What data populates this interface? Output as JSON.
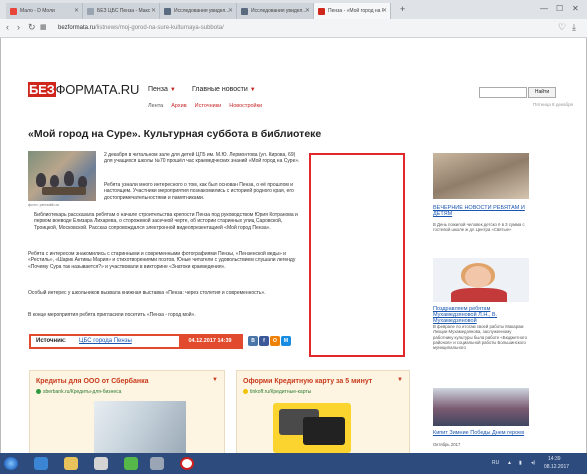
{
  "browser": {
    "tabs": [
      {
        "title": "Мало - D Моли",
        "icon_color": "#e8443a"
      },
      {
        "title": "БЕЗ ЦБС Пенза - Макс",
        "icon_color": "#9aa4b0"
      },
      {
        "title": "Исследования увидел...",
        "icon_color": "#5a6b80"
      },
      {
        "title": "Исследования увидел...",
        "icon_color": "#5a6b80"
      },
      {
        "title": "Пенза - «Мой город на С",
        "icon_color": "#d0271d"
      }
    ],
    "active_tab": 4,
    "url_host": "bezformata.ru",
    "url_path": "/listnews/moj-gorod-na-sure-kulturnaya-subbota/"
  },
  "site": {
    "logo_bez": "БЕЗ",
    "logo_rest": "ФОРМАТА.RU",
    "city": "Пенза",
    "main_news": "Главные новости",
    "subnav": [
      "Лента",
      "Архив",
      "Источники",
      "Новостройки"
    ],
    "search_button": "Найти",
    "date_line": "Пятница 8 декабря"
  },
  "article": {
    "title": "«Мой город на Суре». Культурная суббота в библиотеке",
    "image_caption": "фото: penzalib.ru",
    "p1": "2 декабря в читальном зале для детей ЦГБ им. М.Ю. Лермонтова (ул. Кирова, 69) для учащихся школы №70 прошёл час краеведческих знаний «Мой город на Суре».",
    "p2": "Ребята узнали много интересного о том, как был основан Пенза, о её прошлом и настоящем. Участники мероприятия познакомились с историей родного края, его достопримечательностями и памятниками.",
    "p3": "Библиотекарь рассказала ребятам о начале строительства крепости Пенза под руководством Юрия Котранова и первом воеводе Елизара Лихарева, о сторожевой засечной черте, об истории старинных улиц Саровской, Троицкой, Московской. Рассказ сопровождался электронной видеопрезентацией «Мой город Пенза».",
    "p4": "Ребята с интересом знакомились с старинными и современными фотографиями Пензы, «Пензенской веды» и «Рестиль», «Шарик Активы Мария» и стихотворениями поэтов. Юные читатели с удовольствием слушали легенду «Почему Сура так называется?» и участвовали в викторине «Знатоки краеведения».",
    "p5": "Особый интерес у школьников вызвала книжная выставка «Пенза: через столетия и современность».",
    "p6": "В конце мероприятия ребята пригласили посетить «Пенза - город мой».",
    "source_label": "Источник:",
    "source_value": "ЦБС города Пензы",
    "source_date": "04.12.2017 14:39",
    "share": [
      {
        "label": "В",
        "color": "#4a76a8"
      },
      {
        "label": "f",
        "color": "#3b5998"
      },
      {
        "label": "О",
        "color": "#ee8208"
      },
      {
        "label": "М",
        "color": "#168de2"
      }
    ]
  },
  "ads": [
    {
      "title": "Кредиты для ООО от Сбербанка",
      "sub": "sberbank.ru/Кредиты-для-бизнеса"
    },
    {
      "title": "Оформи Кредитную карту за 5 минут",
      "sub": "tinkoff.ru/Кредитные-карты"
    }
  ],
  "sidebar": [
    {
      "title": "ВЕЧЕРНИЕ НОВОСТИ РЕБЯТАМ И ДЕТЯМ",
      "desc": "В День пожилой человек детско ё в 3 сумма с гостевой школе ж дл Центра «Святые»"
    },
    {
      "title": "Поздравляем ребятам Мухамедзяновой Л.Н., В. Мухамедзяновой",
      "desc": "В феврале по итогам своей работы Макарам Лекции Мухамедзянова, заслуженному работнику культуры была работе «Бюджетного районов» и социальной работы Большинского муниципального"
    },
    {
      "title": "Кипит Зимние Победы Днем героев",
      "desc": "Октябрь 2017"
    }
  ],
  "taskbar": {
    "lang": "RU",
    "time": "14:39",
    "date": "08.12.2017"
  },
  "colors": {
    "brand_red": "#d0271d",
    "taskbar": "#2d4b7c",
    "link_blue": "#1a56b0"
  }
}
